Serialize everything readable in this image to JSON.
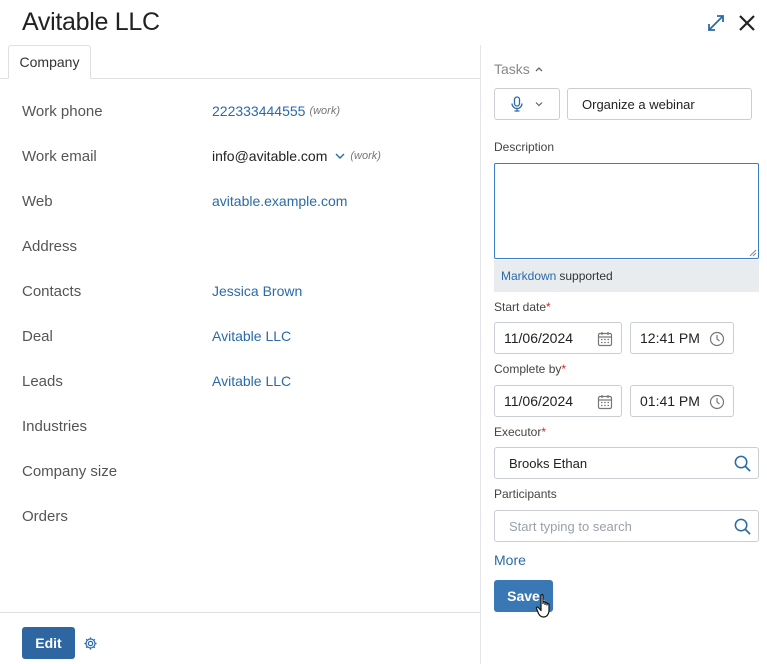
{
  "header": {
    "title": "Avitable LLC"
  },
  "tabs": [
    {
      "label": "Company"
    }
  ],
  "fields": {
    "work_phone": {
      "label": "Work phone",
      "value": "222333444555",
      "hint": "(work)"
    },
    "work_email": {
      "label": "Work email",
      "value": "info@avitable.com",
      "hint": "(work)"
    },
    "web": {
      "label": "Web",
      "value": "avitable.example.com"
    },
    "address": {
      "label": "Address"
    },
    "contacts": {
      "label": "Contacts",
      "value": "Jessica Brown"
    },
    "deal": {
      "label": "Deal",
      "value": "Avitable LLC"
    },
    "leads": {
      "label": "Leads",
      "value": "Avitable LLC"
    },
    "industries": {
      "label": "Industries"
    },
    "company_size": {
      "label": "Company size"
    },
    "orders": {
      "label": "Orders"
    }
  },
  "footer": {
    "edit_label": "Edit"
  },
  "task_panel": {
    "header": "Tasks",
    "task_name": "Organize a webinar",
    "description_label": "Description",
    "description_value": "",
    "markdown_link": "Markdown",
    "markdown_suffix": "supported",
    "start_date_label": "Start date",
    "start_date": "11/06/2024",
    "start_time": "12:41 PM",
    "complete_by_label": "Complete by",
    "complete_date": "11/06/2024",
    "complete_time": "01:41 PM",
    "required_mark": "*",
    "executor_label": "Executor",
    "executor_value": "Brooks Ethan",
    "participants_label": "Participants",
    "participants_placeholder": "Start typing to search",
    "more_label": "More",
    "save_label": "Save"
  },
  "colors": {
    "accent": "#2d66a0",
    "link": "#2b6aa8",
    "required": "#d9262a",
    "focus": "#3a7dc8"
  }
}
